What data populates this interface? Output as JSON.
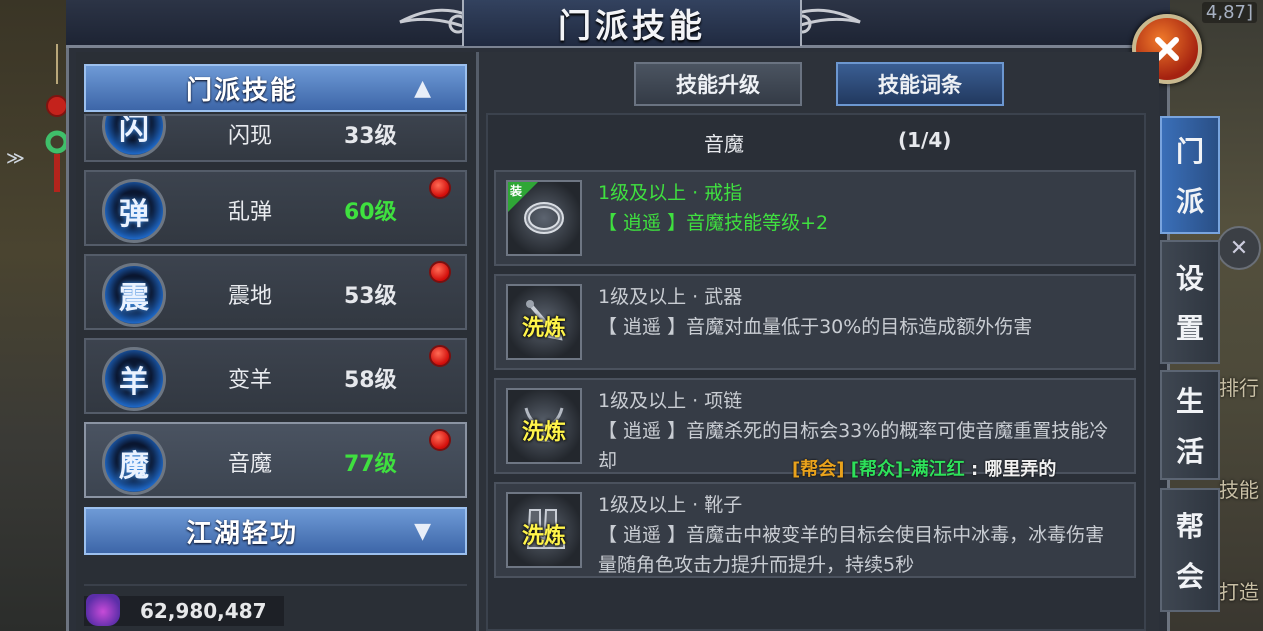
{
  "header": {
    "title": "门派技能",
    "coord_text": "4,87]"
  },
  "world": {
    "chip_ranking": "排行",
    "chip_skill": "技能",
    "chip_forge": "打造"
  },
  "skill_panel": {
    "category_open": {
      "label": "门派技能",
      "icon": "chevron-up-icon"
    },
    "category_closed": {
      "label": "江湖轻功",
      "icon": "chevron-down-icon"
    },
    "skills": [
      {
        "glyph": "闪",
        "name": "闪现",
        "level": "33级",
        "level_color": "#e6e8ec",
        "red_dot": false
      },
      {
        "glyph": "弹",
        "name": "乱弹",
        "level": "60级",
        "level_color": "#3fe03f",
        "red_dot": true
      },
      {
        "glyph": "震",
        "name": "震地",
        "level": "53级",
        "level_color": "#e6e8ec",
        "red_dot": true
      },
      {
        "glyph": "羊",
        "name": "变羊",
        "level": "58级",
        "level_color": "#e6e8ec",
        "red_dot": true
      },
      {
        "glyph": "魔",
        "name": "音魔",
        "level": "77级",
        "level_color": "#3fe03f",
        "red_dot": true,
        "selected": true
      }
    ],
    "currency": {
      "icon": "gem-icon",
      "value": "62,980,487"
    }
  },
  "tabs": {
    "upgrade": "技能升级",
    "affix": "技能词条",
    "active": "affix"
  },
  "affix_list": {
    "skill_name": "音魔",
    "count": "(1/4)",
    "entries": [
      {
        "icon": "ring-icon",
        "badge": "装",
        "wash": "",
        "title": "1级及以上 · 戒指",
        "desc": "【 逍遥 】音魔技能等级+2",
        "active": true
      },
      {
        "icon": "weapon-icon",
        "badge": "",
        "wash": "洗炼",
        "title": "1级及以上 · 武器",
        "desc": "【 逍遥 】音魔对血量低于30%的目标造成额外伤害",
        "active": false
      },
      {
        "icon": "necklace-icon",
        "badge": "",
        "wash": "洗炼",
        "title": "1级及以上 · 项链",
        "desc": "【 逍遥 】音魔杀死的目标会33%的概率可使音魔重置技能冷却",
        "active": false
      },
      {
        "icon": "boots-icon",
        "badge": "",
        "wash": "洗炼",
        "title": "1级及以上 · 靴子",
        "desc": "【 逍遥 】音魔击中被变羊的目标会使目标中冰毒，冰毒伤害量随角色攻击力提升而提升，持续5秒",
        "active": false
      }
    ]
  },
  "chat": {
    "channel": "[帮会]",
    "rank": "[帮众]",
    "sender": "-满江红",
    "separator": " : ",
    "message": "哪里弄的"
  },
  "side_tabs": [
    {
      "label_1": "门",
      "label_2": "派",
      "active": true
    },
    {
      "label_1": "设",
      "label_2": "置",
      "active": false
    },
    {
      "label_1": "生",
      "label_2": "活",
      "active": false
    },
    {
      "label_1": "帮",
      "label_2": "会",
      "active": false
    }
  ],
  "colors": {
    "green": "#3fe03f",
    "gray_text": "#c9cdd3",
    "chat_orange": "#e9a21c",
    "chat_name": "#2ee05a",
    "wash_yellow": "#fff44a"
  }
}
